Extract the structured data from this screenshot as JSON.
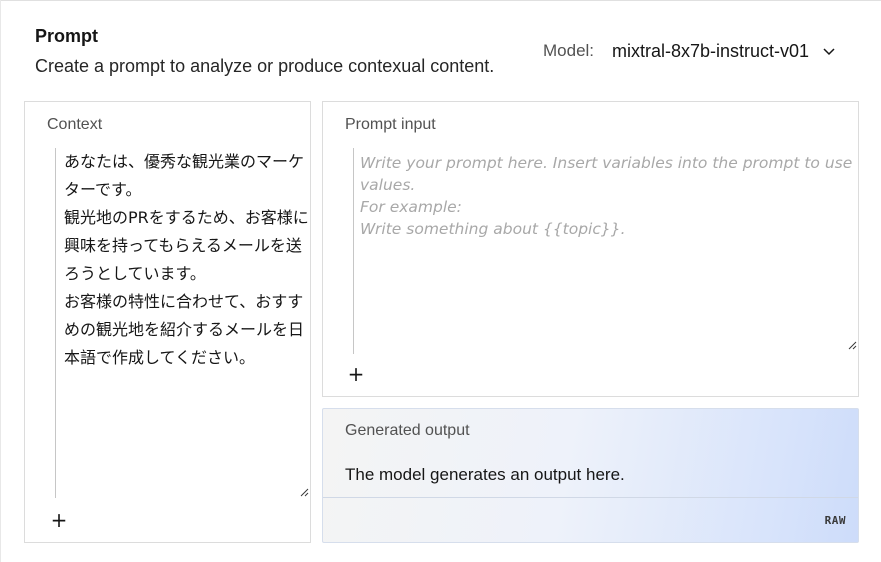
{
  "header": {
    "title": "Prompt",
    "subtitle": "Create a prompt to analyze or produce contexual content."
  },
  "model": {
    "label": "Model:",
    "value": "mixtral-8x7b-instruct-v01",
    "icon": "chevron-down-icon"
  },
  "context": {
    "label": "Context",
    "text": "あなたは、優秀な観光業のマーケターです。\n観光地のPRをするため、お客様に興味を持ってもらえるメールを送ろうとしています。\nお客様の特性に合わせて、おすすめの観光地を紹介するメールを日本語で作成してください。",
    "add_icon": "plus-icon",
    "add_label": "+"
  },
  "prompt_input": {
    "label": "Prompt input",
    "placeholder": "Write your prompt here. Insert variables into the prompt to use values.\nFor example:\nWrite something about {{topic}}.",
    "add_icon": "plus-icon",
    "add_label": "+"
  },
  "generated_output": {
    "label": "Generated output",
    "text": "The model generates an output here.",
    "raw_label": "RAW"
  }
}
